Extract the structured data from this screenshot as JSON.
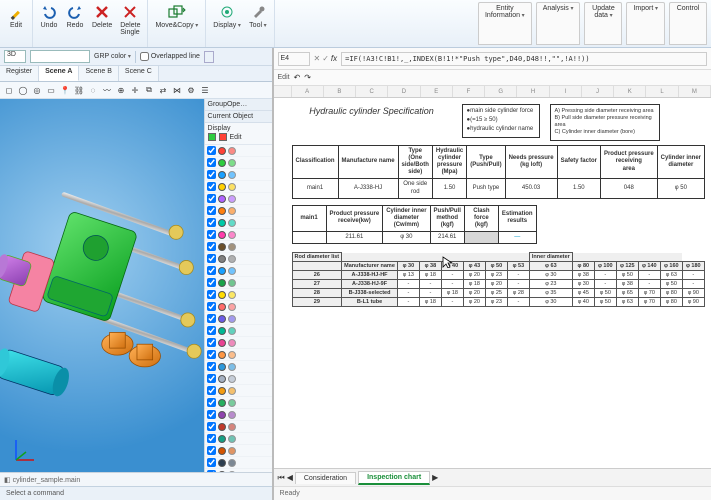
{
  "ribbon": {
    "edit_label": "Edit",
    "undo": "Undo",
    "redo": "Redo",
    "delete": "Delete",
    "delete_dup": "Delete\nSingle",
    "movecopy": "Move&Copy",
    "display": "Display",
    "tool": "Tool"
  },
  "right_tabs": [
    "Entity\nInformation",
    "Analysis",
    "Update\ndata",
    "Import",
    "Control"
  ],
  "toolbar2": {
    "mode": "3D",
    "search_val": "",
    "grp_label": "GRP color",
    "overlap": "Overlapped line"
  },
  "scene_tabs": [
    "Register",
    "Scene A",
    "Scene B",
    "Scene C"
  ],
  "sidepanel": {
    "title": "GroupOpe…",
    "subtitle": "Current Object",
    "legend": [
      {
        "label": "Display",
        "color": "#2ecc40"
      },
      {
        "label": "Edit",
        "color": "#ff4136"
      }
    ],
    "layer_colors": [
      "#ff4136",
      "#2ecc40",
      "#19a0ff",
      "#ffd000",
      "#b062ff",
      "#ff7f0e",
      "#00c9a7",
      "#ff3cac",
      "#6b4f2a",
      "#808080",
      "#19a0ff",
      "#1aa34a",
      "#ffdc00",
      "#ff6b6b",
      "#6c5ce7",
      "#00b894",
      "#e84393",
      "#fd9644",
      "#2d98da",
      "#a5b1c2",
      "#f39c12",
      "#27ae60",
      "#8e44ad",
      "#c0392b",
      "#16a085",
      "#d35400",
      "#2c3e50",
      "#95a5a6"
    ]
  },
  "bottom_tab": "cylinder_sample.main",
  "statusbar": "Select a command",
  "excel": {
    "cell_ref": "E4",
    "formula": "=IF(!A3!C!B1!,_,INDEX(B!1!*\"Push type\",D40,D48!!,\"\",!A!!))",
    "edit_label": "Edit",
    "cols": [
      "A",
      "B",
      "C",
      "D",
      "E",
      "F",
      "G",
      "H",
      "I",
      "J",
      "K",
      "L",
      "M"
    ],
    "title": "Hydraulic cylinder Specification",
    "legend1": [
      "●main side cylinder force",
      "●(=15 ≥ 50)",
      "●hydraulic cylinder name"
    ],
    "legend2": [
      "A) Pressing side diameter receiving area",
      "B) Pull side diameter pressure receiving area",
      "C) Cylinder inner diameter (bore)"
    ],
    "spec_headers1": [
      "Classification",
      "Manufacture name",
      "Type\n(One\nside/Both\nside)",
      "Hydraulic\ncylinder\npressure\n(Mpa)",
      "Type\n(Push/Pull)",
      "Needs pressure\n(kg loft)",
      "Safety factor",
      "Product pressure\nreceiving\narea",
      "Cylinder inner\ndiameter"
    ],
    "spec_row1": [
      "main1",
      "A-J338-HJ",
      "One side rod",
      "1.50",
      "Push type",
      "450.03",
      "1.50",
      "048",
      "φ 50"
    ],
    "spec_headers2": [
      "main1",
      "Product pressure\nreceive(kw)",
      "Cylinder inner\ndiameter\n(Cw/mm)",
      "Push/Pull\nmethod\n(kgf)",
      "Clash\nforce\n(kgf)",
      "Estimation\nresults"
    ],
    "spec_row2": [
      "",
      "211.61",
      "φ 30",
      "214.61",
      "",
      "—"
    ],
    "small_header_top": [
      "Rod diameter list",
      "",
      "",
      "",
      "",
      "",
      "",
      "",
      "Inner diameter",
      "",
      "",
      "",
      "",
      ""
    ],
    "small_headers": [
      "",
      "Manufacturer name",
      "φ 30",
      "φ 38",
      "φ 40",
      "φ 43",
      "φ 50",
      "φ 53",
      "φ 63",
      "φ 80",
      "φ 100",
      "φ 125",
      "φ 140",
      "φ 160",
      "φ 180"
    ],
    "small_rows": [
      [
        "26",
        "A-J338-HJ-HF",
        "φ 13",
        "φ 18",
        "-",
        "φ 20",
        "φ 23",
        "-",
        "φ 30",
        "φ 38",
        "-",
        "φ 50",
        "-",
        "φ 63",
        "-"
      ],
      [
        "27",
        "A-J338-HJ-9F",
        "-",
        "-",
        "-",
        "φ 18",
        "φ 20",
        "-",
        "φ 23",
        "φ 30",
        "-",
        "φ 38",
        "-",
        "φ 50",
        "-"
      ],
      [
        "28",
        "B-J338-selected",
        "-",
        "-",
        "φ 18",
        "φ 20",
        "φ 25",
        "φ 28",
        "φ 35",
        "φ 45",
        "φ 50",
        "φ 65",
        "φ 70",
        "φ 80",
        "φ 90"
      ],
      [
        "29",
        "B-L1 tube",
        "-",
        "φ 18",
        "-",
        "φ 20",
        "φ 23",
        "-",
        "φ 30",
        "φ 40",
        "φ 50",
        "φ 63",
        "φ 70",
        "φ 80",
        "φ 90"
      ]
    ],
    "sheet_tabs": [
      "Consideration",
      "Inspection chart"
    ],
    "active_tab": 1,
    "status": "Ready"
  }
}
